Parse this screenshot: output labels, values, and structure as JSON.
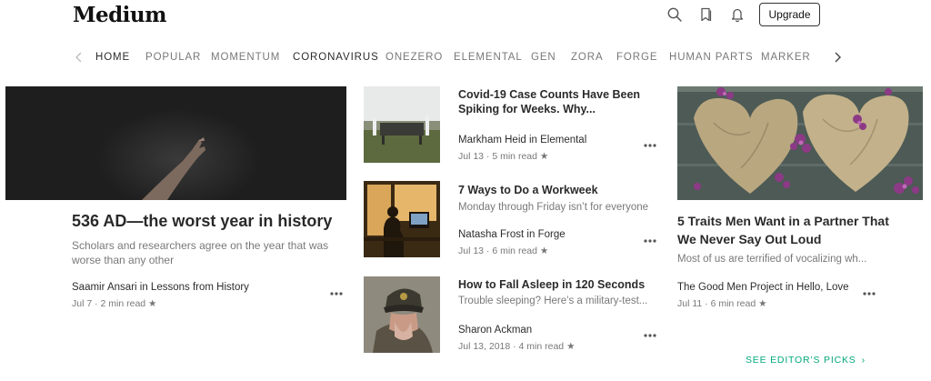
{
  "header": {
    "logo": "Medium",
    "upgrade_label": "Upgrade",
    "icons": [
      "search-icon",
      "bookmark-icon",
      "bell-icon"
    ]
  },
  "nav": {
    "items": [
      {
        "label": "HOME"
      },
      {
        "label": "POPULAR"
      },
      {
        "label": "MOMENTUM"
      },
      {
        "label": "CORONAVIRUS"
      },
      {
        "label": "ONEZERO"
      },
      {
        "label": "ELEMENTAL"
      },
      {
        "label": "GEN"
      },
      {
        "label": "ZORA"
      },
      {
        "label": "FORGE"
      },
      {
        "label": "HUMAN PARTS"
      },
      {
        "label": "MARKER"
      }
    ]
  },
  "main_story": {
    "title": "536 AD—the worst year in history",
    "subtitle": "Scholars and researchers agree on the year that was worse than any other",
    "author": "Saamir Ansari in Lessons from History",
    "meta": "Jul 7 · 2 min read ★"
  },
  "side_stories": [
    {
      "title": "Covid-19 Case Counts Have Been Spiking for Weeks. Why...",
      "subtitle": "",
      "author": "Markham Heid in Elemental",
      "meta": "Jul 13 · 5 min read ★"
    },
    {
      "title": "7 Ways to Do a Workweek",
      "subtitle": "Monday through Friday isn’t for everyone",
      "author": "Natasha Frost in Forge",
      "meta": "Jul 13 · 6 min read ★"
    },
    {
      "title": "How to Fall Asleep in 120 Seconds",
      "subtitle": "Trouble sleeping? Here’s a military-test...",
      "author": "Sharon Ackman",
      "meta": "Jul 13, 2018 · 4 min read ★"
    }
  ],
  "right_story": {
    "title": "5 Traits Men Want in a Partner That We Never Say Out Loud",
    "subtitle": "Most of us are terrified of vocalizing wh...",
    "author": "The Good Men Project in Hello, Love",
    "meta": "Jul 11 · 6 min read ★"
  },
  "editors_picks": {
    "label": "SEE EDITOR’S PICKS",
    "chevron": "›"
  },
  "colors": {
    "accent_green": "#03a87c",
    "text_primary": "#292929",
    "text_secondary": "#757575"
  }
}
